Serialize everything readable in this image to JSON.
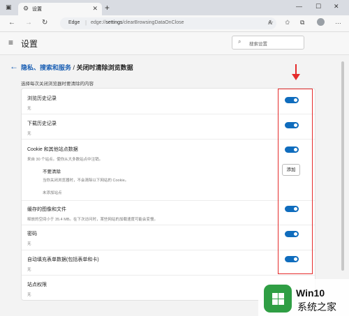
{
  "tab": {
    "title": "设置"
  },
  "address": {
    "brand": "Edge",
    "url_prefix": "edge://",
    "url_bold": "settings",
    "url_rest": "/clearBrowsingDataOnClose"
  },
  "header": {
    "title": "设置",
    "search_placeholder": "搜索设置"
  },
  "breadcrumb": {
    "parent": "隐私、搜索和服务",
    "separator": "/",
    "current": "关闭时清除浏览数据"
  },
  "intro": "选择每次关闭浏览器时要清除的内容",
  "items": [
    {
      "label": "浏览历史记录",
      "sub": "无",
      "enabled": true
    },
    {
      "label": "下载历史记录",
      "sub": "无",
      "enabled": true
    },
    {
      "label": "Cookie 和其他站点数据",
      "sub": "来自 30 个站点。使你从大多数站点中注销。",
      "enabled": true
    },
    {
      "label": "缓存的图像和文件",
      "sub": "释放的空间小于 35.4 MB。在下次访问时，某些网站的加载速度可能会变慢。",
      "enabled": true
    },
    {
      "label": "密码",
      "sub": "无",
      "enabled": true
    },
    {
      "label": "自动填充表单数据(包括表单和卡)",
      "sub": "无",
      "enabled": true
    },
    {
      "label": "站点权限",
      "sub": "无"
    }
  ],
  "exceptions": {
    "title": "不要清除",
    "desc": "当你关闭浏览器时，不会清除以下网站的 Cookie。",
    "empty": "未添加站点",
    "add_button": "添加"
  },
  "watermark": {
    "brand": "Win10",
    "sub": "系统之家",
    "logo_color": "#2f9e44"
  },
  "colors": {
    "accent": "#0f6cbd",
    "link": "#1a5fb4",
    "annotation": "#e52b2b"
  }
}
